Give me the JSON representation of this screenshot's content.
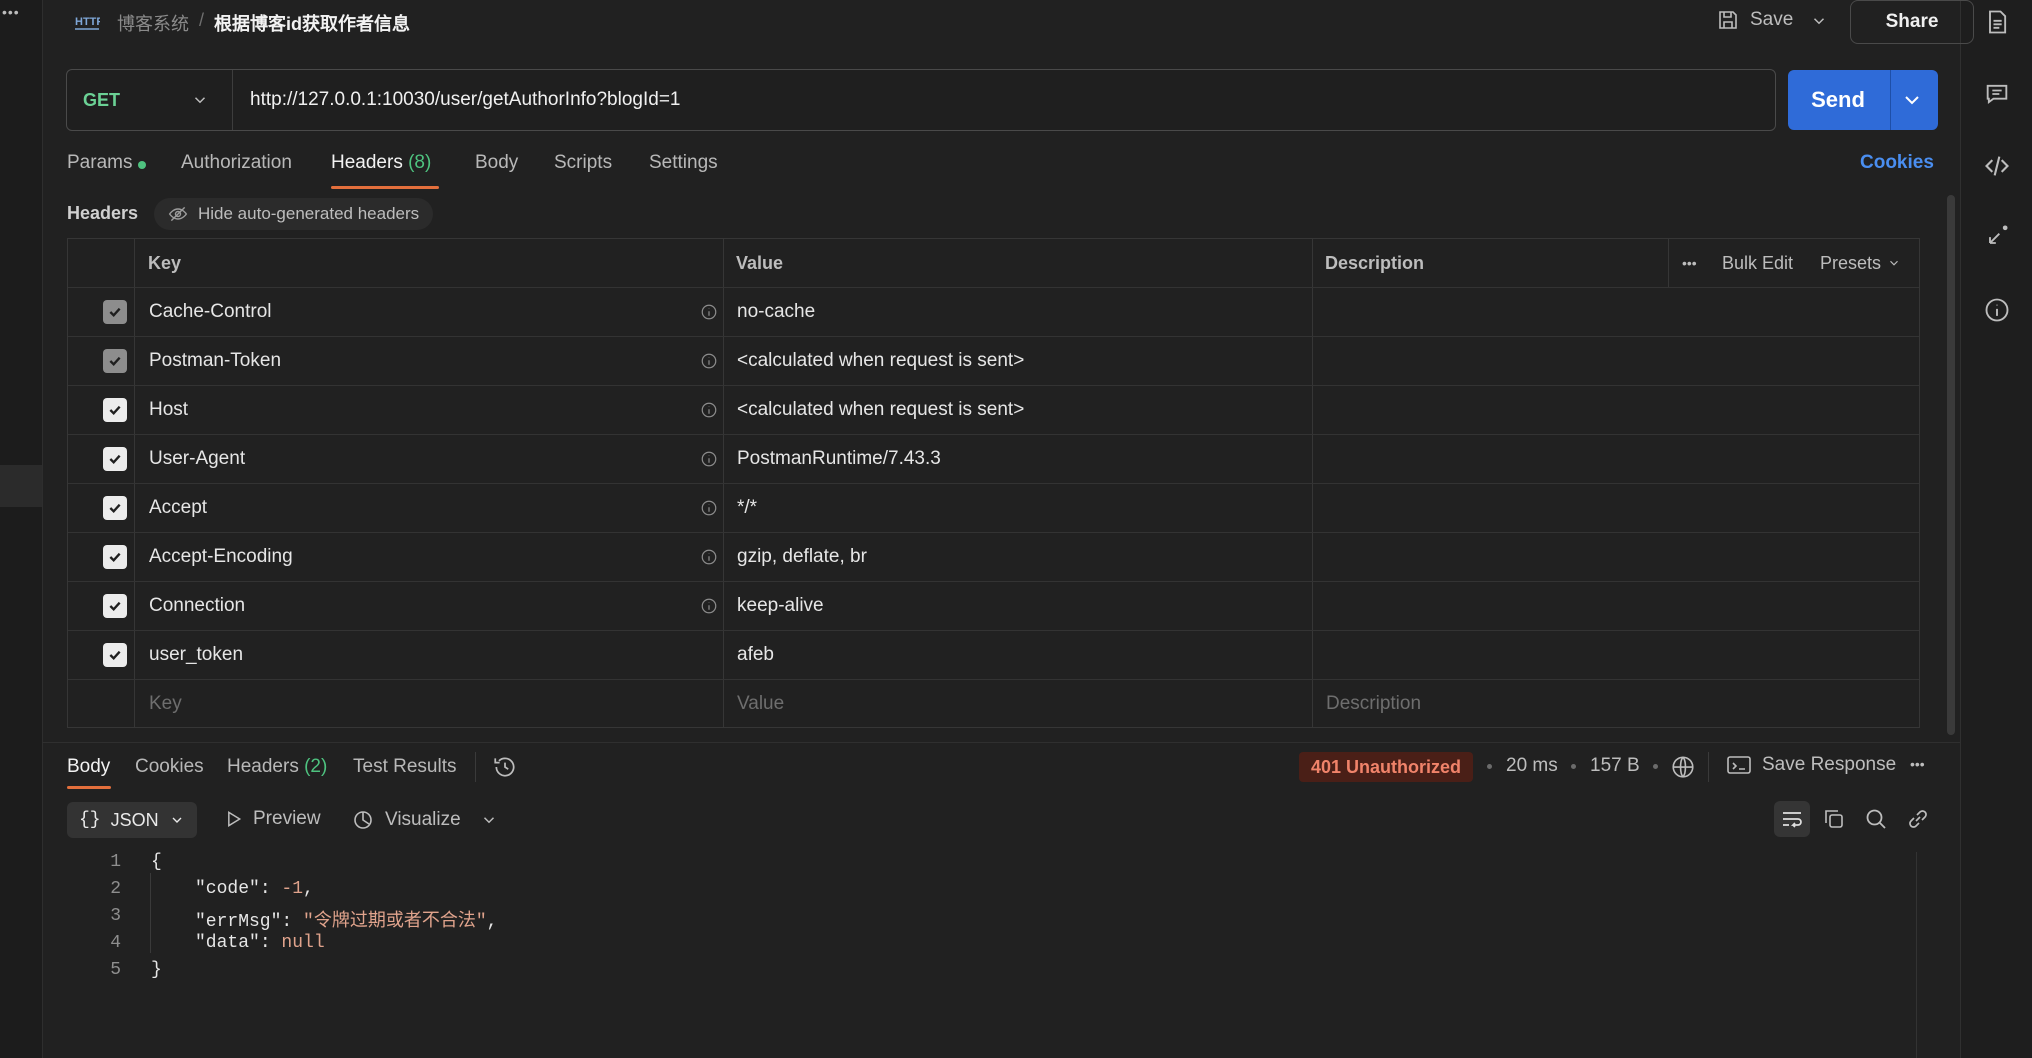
{
  "header": {
    "breadcrumb_parent": "博客系统",
    "breadcrumb_sep": "/",
    "request_name": "根据博客id获取作者信息",
    "save_label": "Save",
    "share_label": "Share"
  },
  "request": {
    "method": "GET",
    "url": "http://127.0.0.1:10030/user/getAuthorInfo?blogId=1",
    "send_label": "Send"
  },
  "tabs": {
    "params": "Params",
    "authorization": "Authorization",
    "headers": "Headers",
    "headers_count": "(8)",
    "body": "Body",
    "scripts": "Scripts",
    "settings": "Settings",
    "cookies": "Cookies"
  },
  "headers_section": {
    "title": "Headers",
    "hide_auto": "Hide auto-generated headers",
    "col_key": "Key",
    "col_value": "Value",
    "col_description": "Description",
    "bulk_edit": "Bulk Edit",
    "presets": "Presets",
    "rows": [
      {
        "key": "Cache-Control",
        "value": "no-cache",
        "checked": true,
        "disabled": true,
        "info": true
      },
      {
        "key": "Postman-Token",
        "value": "<calculated when request is sent>",
        "checked": true,
        "disabled": true,
        "info": true
      },
      {
        "key": "Host",
        "value": "<calculated when request is sent>",
        "checked": true,
        "disabled": false,
        "info": true
      },
      {
        "key": "User-Agent",
        "value": "PostmanRuntime/7.43.3",
        "checked": true,
        "disabled": false,
        "info": true
      },
      {
        "key": "Accept",
        "value": "*/*",
        "checked": true,
        "disabled": false,
        "info": true
      },
      {
        "key": "Accept-Encoding",
        "value": "gzip, deflate, br",
        "checked": true,
        "disabled": false,
        "info": true
      },
      {
        "key": "Connection",
        "value": "keep-alive",
        "checked": true,
        "disabled": false,
        "info": true
      },
      {
        "key": "user_token",
        "value": "afeb",
        "checked": true,
        "disabled": false,
        "info": false
      }
    ],
    "placeholder_key": "Key",
    "placeholder_value": "Value",
    "placeholder_description": "Description"
  },
  "response": {
    "tabs": {
      "body": "Body",
      "cookies": "Cookies",
      "headers": "Headers",
      "headers_count": "(2)",
      "test_results": "Test Results"
    },
    "status": "401 Unauthorized",
    "time": "20 ms",
    "size": "157 B",
    "save_response": "Save Response",
    "format": "JSON",
    "preview": "Preview",
    "visualize": "Visualize",
    "line_numbers": [
      "1",
      "2",
      "3",
      "4",
      "5"
    ],
    "json": {
      "open": "{",
      "code_key": "\"code\"",
      "code_val": "-1",
      "errmsg_key": "\"errMsg\"",
      "errmsg_val": "\"令牌过期或者不合法\"",
      "data_key": "\"data\"",
      "data_val": "null",
      "close": "}"
    }
  }
}
